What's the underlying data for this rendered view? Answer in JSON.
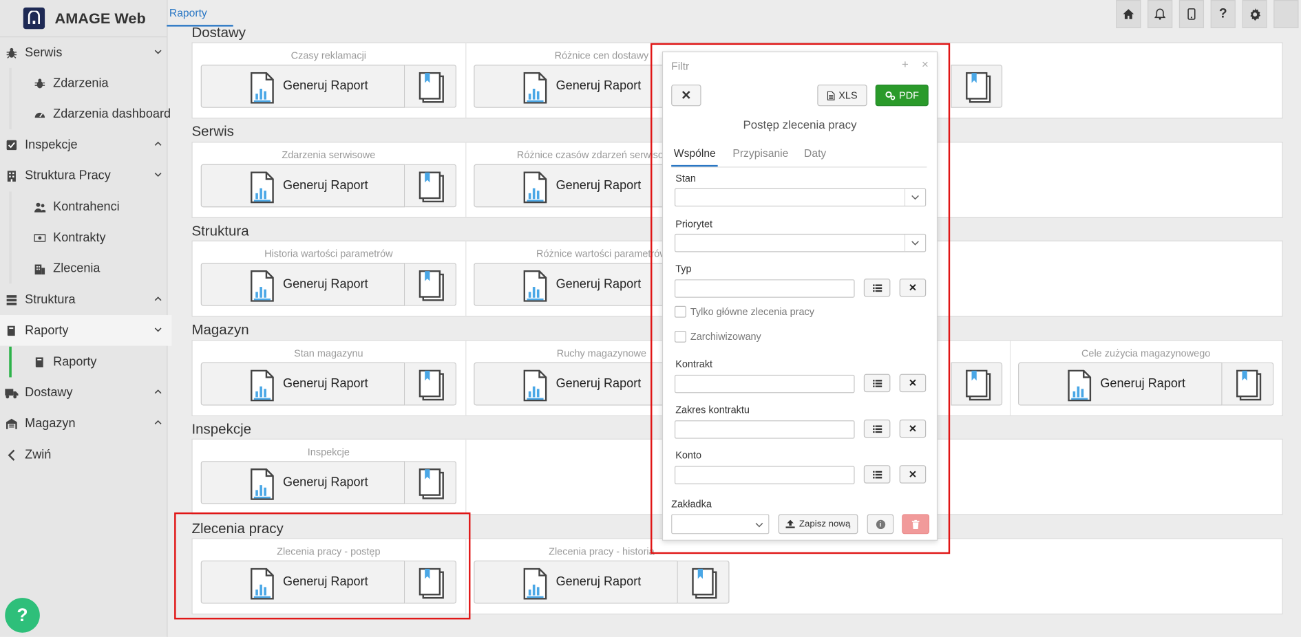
{
  "app": {
    "title": "AMAGE Web"
  },
  "breadcrumb": {
    "current": "Raporty"
  },
  "sidebar": {
    "items": [
      {
        "label": "Serwis",
        "level": "top"
      },
      {
        "label": "Zdarzenia",
        "level": "sub"
      },
      {
        "label": "Zdarzenia dashboard",
        "level": "sub"
      },
      {
        "label": "Inspekcje",
        "level": "top"
      },
      {
        "label": "Struktura Pracy",
        "level": "top"
      },
      {
        "label": "Kontrahenci",
        "level": "sub"
      },
      {
        "label": "Kontrakty",
        "level": "sub"
      },
      {
        "label": "Zlecenia",
        "level": "sub"
      },
      {
        "label": "Struktura",
        "level": "top"
      },
      {
        "label": "Raporty",
        "level": "top"
      },
      {
        "label": "Raporty",
        "level": "sub",
        "active": true
      },
      {
        "label": "Dostawy",
        "level": "top"
      },
      {
        "label": "Magazyn",
        "level": "top"
      },
      {
        "label": "Zwiń",
        "level": "top"
      }
    ]
  },
  "topbar": {
    "help_label": "?"
  },
  "buttons": {
    "generate_label": "Generuj Raport"
  },
  "sections": [
    {
      "title": "Dostawy",
      "cards": [
        "Czasy reklamacji",
        "Różnice cen dostawy"
      ]
    },
    {
      "title": "Serwis",
      "cards": [
        "Zdarzenia serwisowe",
        "Różnice czasów zdarzeń serwisowych"
      ]
    },
    {
      "title": "Struktura",
      "cards": [
        "Historia wartości parametrów",
        "Różnice wartości parametrów"
      ]
    },
    {
      "title": "Magazyn",
      "cards": [
        "Stan magazynu",
        "Ruchy magazynowe",
        "Cele zużycia magazynowego"
      ]
    },
    {
      "title": "Inspekcje",
      "cards": [
        "Inspekcje"
      ]
    },
    {
      "title": "Zlecenia pracy",
      "cards": [
        "Zlecenia pracy - postęp",
        "Zlecenia pracy - historia"
      ]
    }
  ],
  "dialog": {
    "title": "Filtr",
    "plus": "+",
    "close": "×",
    "cancel_symbol": "✕",
    "xls_label": "XLS",
    "pdf_label": "PDF",
    "subtitle": "Postęp zlecenia pracy",
    "tabs": [
      "Wspólne",
      "Przypisanie",
      "Daty"
    ],
    "fields": {
      "stan": "Stan",
      "priorytet": "Priorytet",
      "typ": "Typ",
      "only_main": "Tylko główne zlecenia pracy",
      "archived": "Zarchiwizowany",
      "kontrakt": "Kontrakt",
      "zakres": "Zakres kontraktu",
      "konto": "Konto",
      "zakladka": "Zakładka"
    },
    "save_new_label": "Zapisz nową",
    "clear_symbol": "✕",
    "info_symbol": "i"
  },
  "colors": {
    "accent": "#2a77c4",
    "green": "#2a9a2a",
    "highlight_red": "#e01515",
    "fab": "#2ebf7a"
  }
}
